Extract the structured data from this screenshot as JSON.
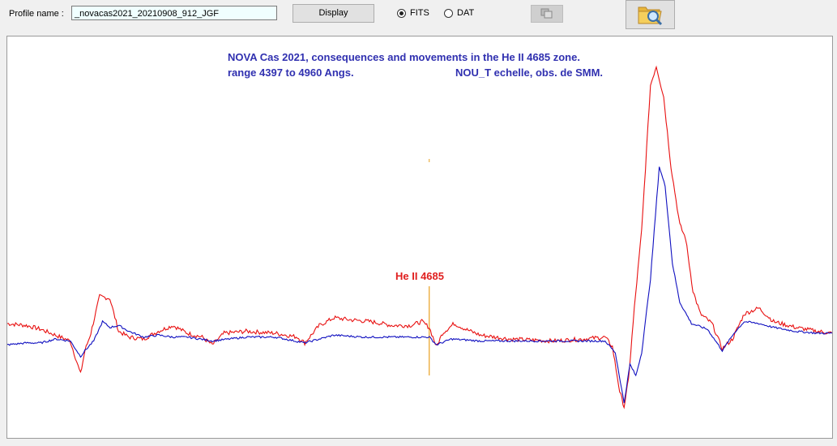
{
  "form": {
    "profile_label": "Profile name :",
    "profile_value": "_novacas2021_20210908_912_JGF",
    "display_label": "Display",
    "radio_fits": "FITS",
    "radio_dat": "DAT",
    "selected_format": "FITS"
  },
  "icons": {
    "copy": "copy-icon",
    "open": "folder-search-icon"
  },
  "colors": {
    "series_red": "#e81010",
    "series_blue": "#1010c0",
    "marker": "#e8a020",
    "title": "#3030b0"
  },
  "chart_data": {
    "type": "line",
    "title": "NOVA Cas 2021, consequences and movements in the He II 4685 zone.",
    "subtitle_left": "range 4397 to 4960 Angs.",
    "subtitle_right": "NOU_T echelle, obs. de SMM.",
    "xlim": [
      4397,
      4960
    ],
    "annotation": {
      "label": "He II 4685",
      "x": 4685
    },
    "series": [
      {
        "color": "red",
        "points": [
          [
            4397,
            0.07
          ],
          [
            4410,
            0.06
          ],
          [
            4420,
            0.04
          ],
          [
            4430,
            0.01
          ],
          [
            4440,
            -0.02
          ],
          [
            4447,
            -0.19
          ],
          [
            4450,
            -0.07
          ],
          [
            4454,
            0.02
          ],
          [
            4460,
            0.21
          ],
          [
            4467,
            0.2
          ],
          [
            4473,
            0.03
          ],
          [
            4480,
            0.0
          ],
          [
            4490,
            -0.01
          ],
          [
            4500,
            0.03
          ],
          [
            4510,
            0.06
          ],
          [
            4520,
            0.02
          ],
          [
            4530,
            0.0
          ],
          [
            4537,
            -0.04
          ],
          [
            4545,
            0.02
          ],
          [
            4560,
            0.03
          ],
          [
            4580,
            0.02
          ],
          [
            4595,
            0.0
          ],
          [
            4600,
            -0.03
          ],
          [
            4610,
            0.06
          ],
          [
            4620,
            0.1
          ],
          [
            4630,
            0.09
          ],
          [
            4645,
            0.08
          ],
          [
            4660,
            0.06
          ],
          [
            4672,
            0.06
          ],
          [
            4680,
            0.08
          ],
          [
            4685,
            0.05
          ],
          [
            4690,
            -0.05
          ],
          [
            4694,
            0.02
          ],
          [
            4702,
            0.07
          ],
          [
            4710,
            0.04
          ],
          [
            4720,
            0.01
          ],
          [
            4740,
            -0.01
          ],
          [
            4770,
            -0.02
          ],
          [
            4790,
            -0.01
          ],
          [
            4805,
            0.0
          ],
          [
            4810,
            -0.05
          ],
          [
            4815,
            -0.28
          ],
          [
            4818,
            -0.36
          ],
          [
            4821,
            -0.22
          ],
          [
            4825,
            0.15
          ],
          [
            4830,
            0.55
          ],
          [
            4836,
            1.3
          ],
          [
            4840,
            1.4
          ],
          [
            4845,
            1.24
          ],
          [
            4850,
            0.88
          ],
          [
            4856,
            0.58
          ],
          [
            4860,
            0.51
          ],
          [
            4865,
            0.24
          ],
          [
            4870,
            0.12
          ],
          [
            4878,
            0.07
          ],
          [
            4885,
            -0.06
          ],
          [
            4892,
            -0.01
          ],
          [
            4900,
            0.12
          ],
          [
            4910,
            0.15
          ],
          [
            4920,
            0.08
          ],
          [
            4935,
            0.05
          ],
          [
            4950,
            0.03
          ],
          [
            4960,
            0.02
          ]
        ]
      },
      {
        "color": "blue",
        "points": [
          [
            4397,
            -0.04
          ],
          [
            4410,
            -0.03
          ],
          [
            4420,
            -0.03
          ],
          [
            4430,
            -0.01
          ],
          [
            4440,
            -0.02
          ],
          [
            4447,
            -0.1
          ],
          [
            4450,
            -0.07
          ],
          [
            4456,
            -0.02
          ],
          [
            4462,
            0.08
          ],
          [
            4467,
            0.05
          ],
          [
            4473,
            0.06
          ],
          [
            4480,
            0.03
          ],
          [
            4490,
            0.0
          ],
          [
            4500,
            0.01
          ],
          [
            4510,
            0.0
          ],
          [
            4520,
            0.0
          ],
          [
            4537,
            -0.02
          ],
          [
            4560,
            0.0
          ],
          [
            4580,
            0.0
          ],
          [
            4600,
            -0.03
          ],
          [
            4620,
            0.01
          ],
          [
            4640,
            0.0
          ],
          [
            4660,
            0.0
          ],
          [
            4685,
            0.0
          ],
          [
            4690,
            -0.04
          ],
          [
            4700,
            -0.01
          ],
          [
            4720,
            -0.02
          ],
          [
            4760,
            -0.02
          ],
          [
            4790,
            -0.02
          ],
          [
            4805,
            -0.02
          ],
          [
            4812,
            -0.08
          ],
          [
            4818,
            -0.34
          ],
          [
            4822,
            -0.14
          ],
          [
            4826,
            -0.2
          ],
          [
            4830,
            -0.08
          ],
          [
            4836,
            0.3
          ],
          [
            4842,
            0.88
          ],
          [
            4846,
            0.78
          ],
          [
            4851,
            0.38
          ],
          [
            4856,
            0.18
          ],
          [
            4864,
            0.07
          ],
          [
            4875,
            0.04
          ],
          [
            4885,
            -0.07
          ],
          [
            4893,
            0.02
          ],
          [
            4900,
            0.08
          ],
          [
            4910,
            0.07
          ],
          [
            4920,
            0.05
          ],
          [
            4935,
            0.03
          ],
          [
            4950,
            0.02
          ],
          [
            4960,
            0.02
          ]
        ]
      }
    ]
  }
}
